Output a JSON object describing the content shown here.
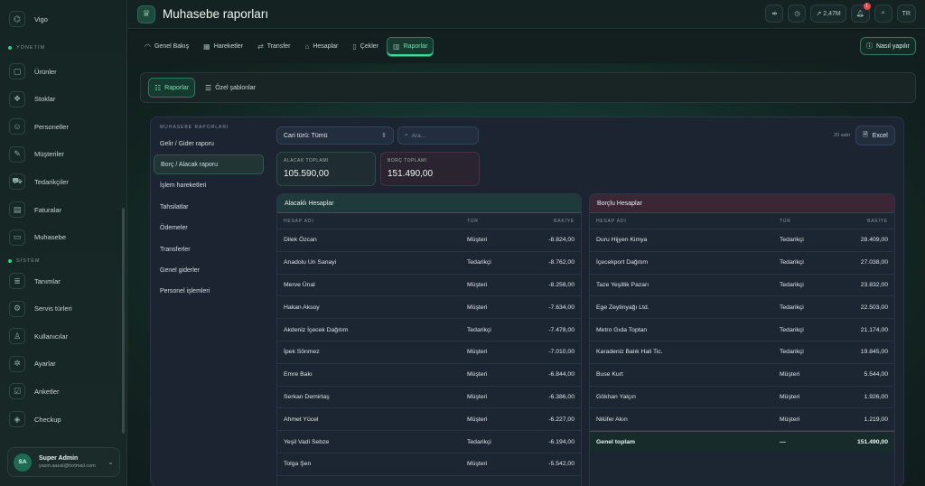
{
  "sidebar": {
    "top_item": "Vigo",
    "sections": [
      {
        "title": "YÖNETİM",
        "items": [
          {
            "label": "Ürünler",
            "icon": "box-icon"
          },
          {
            "label": "Stoklar",
            "icon": "stack-icon"
          },
          {
            "label": "Personeller",
            "icon": "users-icon"
          },
          {
            "label": "Müşteriler",
            "icon": "customer-icon"
          },
          {
            "label": "Tedarikçiler",
            "icon": "truck-icon"
          },
          {
            "label": "Faturalar",
            "icon": "invoice-icon"
          },
          {
            "label": "Muhasebe",
            "icon": "accounting-icon"
          }
        ]
      },
      {
        "title": "SİSTEM",
        "items": [
          {
            "label": "Tanımlar",
            "icon": "definitions-icon"
          },
          {
            "label": "Servis türleri",
            "icon": "service-icon"
          },
          {
            "label": "Kullanıcılar",
            "icon": "user-icon"
          },
          {
            "label": "Ayarlar",
            "icon": "gear-icon"
          },
          {
            "label": "Anketler",
            "icon": "survey-icon"
          },
          {
            "label": "Checkup",
            "icon": "checkup-icon"
          }
        ]
      }
    ],
    "user": {
      "initials": "SA",
      "name": "Super Admin",
      "email": "yasin.aasal@hotmail.com"
    }
  },
  "header": {
    "title": "Muhasebe raporları",
    "balance": "2,47M",
    "notification_count": "1",
    "language": "TR"
  },
  "nav": {
    "tabs": [
      {
        "label": "Genel Bakış",
        "icon": "gauge-icon"
      },
      {
        "label": "Hareketler",
        "icon": "grid-icon"
      },
      {
        "label": "Transfer",
        "icon": "transfer-icon"
      },
      {
        "label": "Hesaplar",
        "icon": "bank-icon"
      },
      {
        "label": "Çekler",
        "icon": "check-doc-icon"
      },
      {
        "label": "Raporlar",
        "icon": "chart-icon"
      }
    ],
    "active_tab": "Raporlar",
    "help_label": "Nasıl yapılır"
  },
  "subtabs": {
    "reports": "Raporlar",
    "templates": "Özel şablonlar"
  },
  "reports": {
    "nav_title": "MUHASEBE RAPORLARI",
    "items": [
      "Gelir / Gider raporu",
      "Borç / Alacak raporu",
      "İşlem hareketleri",
      "Tahsilatlar",
      "Ödemeler",
      "Transferler",
      "Genel giderler",
      "Personel işlemleri"
    ],
    "active_item": "Borç / Alacak raporu"
  },
  "filters": {
    "account_type": "Cari türü: Tümü",
    "search_placeholder": "Ara...",
    "row_count": "20 satır",
    "excel_label": "Excel"
  },
  "summary": {
    "credit_label": "ALACAK TOPLAMI",
    "credit_value": "105.590,00",
    "debit_label": "BORÇ TOPLAMI",
    "debit_value": "151.490,00"
  },
  "credit_table": {
    "title": "Alacaklı Hesaplar",
    "columns": [
      "HESAP ADI",
      "TÜR",
      "BAKİYE"
    ],
    "rows": [
      [
        "Dilek Özcan",
        "Müşteri",
        "-8.824,00"
      ],
      [
        "Anadolu Un Sanayi",
        "Tedarikçi",
        "-8.762,00"
      ],
      [
        "Merve Ünal",
        "Müşteri",
        "-8.258,00"
      ],
      [
        "Hakan Aksoy",
        "Müşteri",
        "-7.634,00"
      ],
      [
        "Akdeniz İçecek Dağıtım",
        "Tedarikçi",
        "-7.478,00"
      ],
      [
        "İpek Sönmez",
        "Müşteri",
        "-7.010,00"
      ],
      [
        "Emre Bakı",
        "Müşteri",
        "-6.844,00"
      ],
      [
        "Serkan Demirtaş",
        "Müşteri",
        "-6.386,00"
      ],
      [
        "Ahmet Yücel",
        "Müşteri",
        "-6.227,00"
      ],
      [
        "Yeşil Vadi Sebze",
        "Tedarikçi",
        "-6.194,00"
      ],
      [
        "Tolga Şen",
        "Müşteri",
        "-5.542,00"
      ]
    ]
  },
  "debit_table": {
    "title": "Borçlu Hesaplar",
    "columns": [
      "HESAP ADI",
      "TÜR",
      "BAKİYE"
    ],
    "rows": [
      [
        "Duru Hijyen Kimya",
        "Tedarikçi",
        "28.409,00"
      ],
      [
        "İçecekport Dağıtım",
        "Tedarikçi",
        "27.038,00"
      ],
      [
        "Taze Yeşillik Pazarı",
        "Tedarikçi",
        "23.832,00"
      ],
      [
        "Ege Zeytinyağı Ltd.",
        "Tedarikçi",
        "22.503,00"
      ],
      [
        "Metro Gıda Toptan",
        "Tedarikçi",
        "21.174,00"
      ],
      [
        "Karadeniz Balık Hali Tic.",
        "Tedarikçi",
        "19.845,00"
      ],
      [
        "Buse Kurt",
        "Müşteri",
        "5.544,00"
      ],
      [
        "Gökhan Yalçın",
        "Müşteri",
        "1.926,00"
      ],
      [
        "Nilüfer Akın",
        "Müşteri",
        "1.219,00"
      ]
    ],
    "total": [
      "Genel toplam",
      "—",
      "151.490,00"
    ]
  }
}
